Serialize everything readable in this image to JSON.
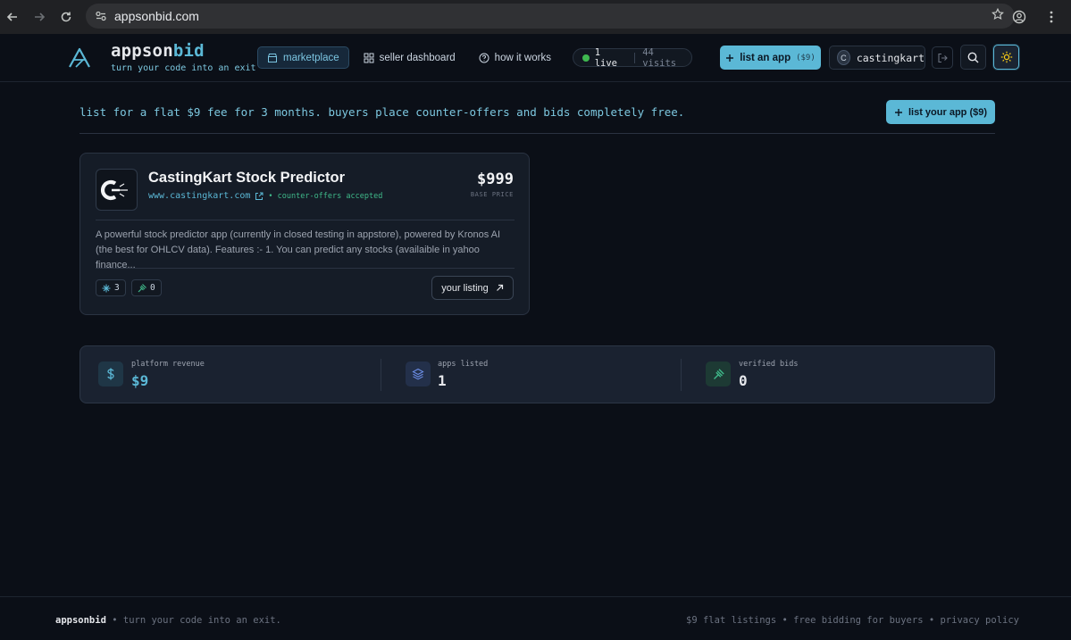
{
  "browser": {
    "url": "appsonbid.com",
    "icons": [
      "back-icon",
      "forward-icon",
      "reload-icon",
      "site-settings-icon",
      "star-icon",
      "profile-icon",
      "menu-icon"
    ]
  },
  "header": {
    "brand_prefix": "appson",
    "brand_suffix": "bid",
    "tagline": "turn your code into an exit",
    "nav": [
      {
        "label": "marketplace",
        "icon": "store-icon",
        "active": true
      },
      {
        "label": "seller dashboard",
        "icon": "grid-icon",
        "active": false
      },
      {
        "label": "how it works",
        "icon": "help-circle-icon",
        "active": false
      }
    ],
    "live_label": "1 live",
    "visits_label": "44 visits",
    "list_button_label": "list an app",
    "list_button_fee": "($9)",
    "user_initial": "C",
    "username": "castingkart",
    "accent_color": "#5bb8d6"
  },
  "banner": {
    "text": "list for a flat $9 fee for 3 months. buyers place counter-offers and bids completely free.",
    "button_label": "list your app ($9)"
  },
  "listing": {
    "title": "CastingKart Stock Predictor",
    "url": "www.castingkart.com",
    "offers_note": "• counter-offers accepted",
    "price": "$999",
    "price_label": "BASE PRICE",
    "description": "A powerful stock predictor app (currently in closed testing in appstore), powered by Kronos AI (the best for OHLCV data). Features :- 1. You can predict any stocks (availaible in yahoo finance...",
    "views_count": "3",
    "bids_count": "0",
    "action_label": "your listing"
  },
  "stats": [
    {
      "label": "platform revenue",
      "value": "$9",
      "icon": "dollar-icon",
      "color": "#5bb8d6"
    },
    {
      "label": "apps listed",
      "value": "1",
      "icon": "layers-icon",
      "color": "#e5e7eb"
    },
    {
      "label": "verified bids",
      "value": "0",
      "icon": "gavel-icon",
      "color": "#e5e7eb"
    }
  ],
  "footer": {
    "brand": "appsonbid",
    "tagline": "• turn your code into an exit.",
    "right": "$9 flat listings • free bidding for buyers • privacy policy"
  }
}
